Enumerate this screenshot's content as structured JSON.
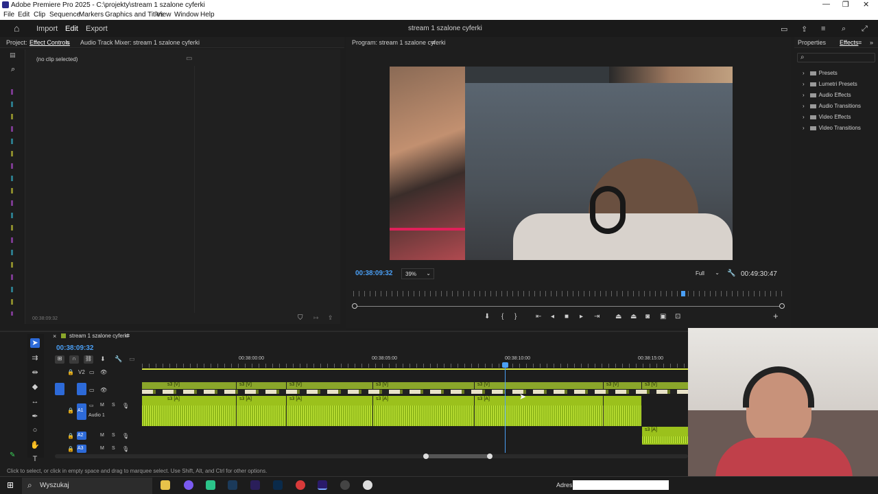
{
  "window": {
    "title": "Adobe Premiere Pro 2025 - C:\\projekty\\stream 1 szalone cyferki"
  },
  "menu": [
    "File",
    "Edit",
    "Clip",
    "Sequence",
    "Markers",
    "Graphics and Titles",
    "View",
    "Window",
    "Help"
  ],
  "workspace": {
    "import": "Import",
    "edit": "Edit",
    "export": "Export",
    "sequence_title": "stream 1 szalone cyferki"
  },
  "left_panel": {
    "project_tab": "Project:",
    "effect_controls_tab": "Effect Controls",
    "mixer_tab": "Audio Track Mixer: stream 1 szalone cyferki",
    "no_clip": "(no clip selected)",
    "timecode": "00:38:09:32"
  },
  "program": {
    "tab": "Program: stream 1 szalone cyferki",
    "timecode": "00:38:09:32",
    "zoom": "39%",
    "quality": "Full",
    "duration": "00:49:30:47"
  },
  "effects": {
    "properties_tab": "Properties",
    "effects_tab": "Effects",
    "items": [
      "Presets",
      "Lumetri Presets",
      "Audio Effects",
      "Audio Transitions",
      "Video Effects",
      "Video Transitions"
    ]
  },
  "timeline": {
    "sequence_tab": "stream 1 szalone cyferki",
    "timecode": "00:38:09:32",
    "ruler": [
      "00:38:00:00",
      "00:38:05:00",
      "00:38:10:00",
      "00:38:15:00"
    ],
    "tracks": {
      "v2": "V2",
      "a1": "A1",
      "a1_name": "Audio 1",
      "a2": "A2",
      "a3": "A3",
      "m": "M",
      "s": "S"
    },
    "clip_v": "s3 [V]",
    "clip_a": "s3 [A]"
  },
  "status": "Click to select, or click in empty space and drag to marquee select. Use Shift, Alt, and Ctrl for other options.",
  "taskbar": {
    "search": "Wyszukaj",
    "address_label": "Adres"
  }
}
